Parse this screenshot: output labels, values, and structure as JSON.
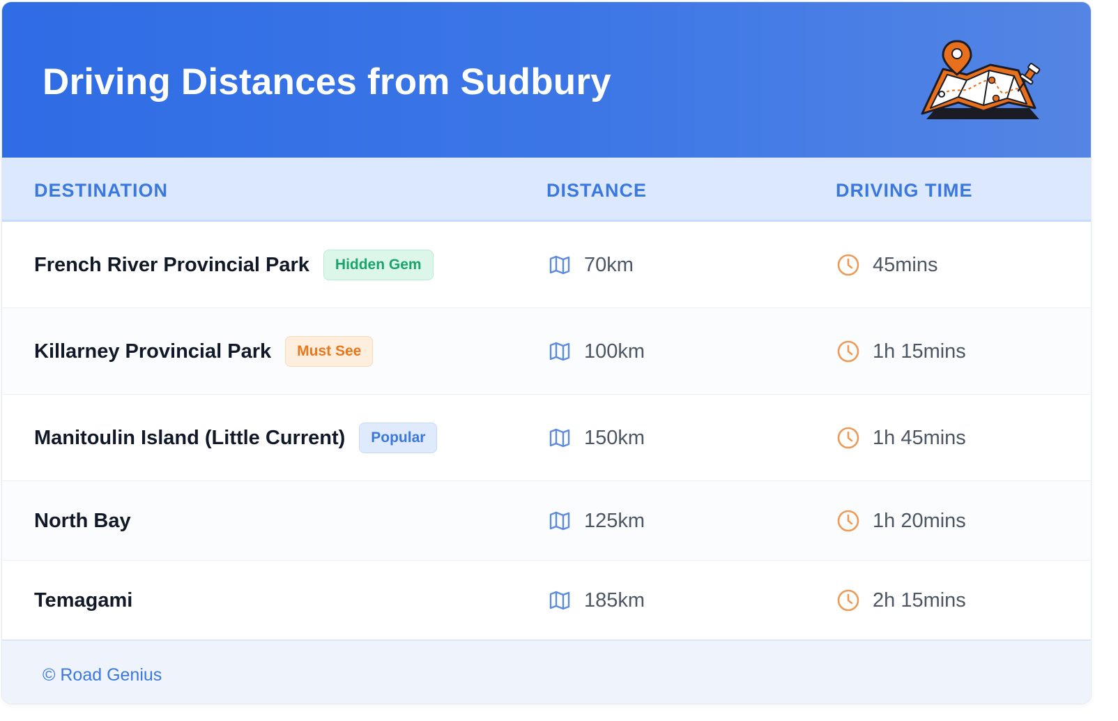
{
  "header": {
    "title": "Driving Distances from Sudbury",
    "illustration_icon": "map-pin-illustration",
    "background": "#2f6ce5"
  },
  "table": {
    "columns": [
      "DESTINATION",
      "DISTANCE",
      "DRIVING TIME"
    ],
    "header_color": "#3b78dd",
    "distance_icon": "map-icon",
    "time_icon": "clock-icon",
    "rows": [
      {
        "destination": "French River Provincial Park",
        "badge": "Hidden Gem",
        "badge_style": "green",
        "distance": "70km",
        "time": "45mins"
      },
      {
        "destination": "Killarney Provincial Park",
        "badge": "Must See",
        "badge_style": "orange",
        "distance": "100km",
        "time": "1h 15mins"
      },
      {
        "destination": "Manitoulin Island (Little Current)",
        "badge": "Popular",
        "badge_style": "blue",
        "distance": "150km",
        "time": "1h 45mins"
      },
      {
        "destination": "North Bay",
        "badge": "",
        "badge_style": "",
        "distance": "125km",
        "time": "1h 20mins"
      },
      {
        "destination": "Temagami",
        "badge": "",
        "badge_style": "",
        "distance": "185km",
        "time": "2h 15mins"
      }
    ]
  },
  "badge_colors": {
    "green": {
      "text": "#1aa46a",
      "bg": "#dcf7ea",
      "border": "#b6ecd2"
    },
    "orange": {
      "text": "#e8771e",
      "bg": "#fdeedd",
      "border": "#f9d8b4"
    },
    "blue": {
      "text": "#3b78dd",
      "bg": "#dfeafd",
      "border": "#c4d9fa"
    }
  },
  "footer": {
    "credit": "© Road Genius"
  }
}
